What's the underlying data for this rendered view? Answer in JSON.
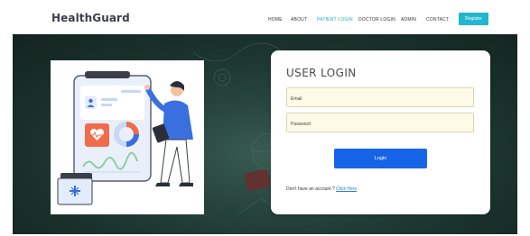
{
  "header": {
    "brand": "HealthGuard",
    "nav": [
      {
        "label": "HOME",
        "active": false
      },
      {
        "label": "ABOUT",
        "active": false
      },
      {
        "label": "PATIENT LOGIN",
        "active": true
      },
      {
        "label": "DOCTOR LOGIN",
        "active": false
      },
      {
        "label": "ADMIN",
        "active": false
      },
      {
        "label": "CONTACT",
        "active": false
      }
    ],
    "register_label": "Register"
  },
  "login": {
    "title": "USER LOGIN",
    "email_placeholder": "Email",
    "password_placeholder": "Password",
    "button_label": "Login",
    "account_prompt": "Don't have an account ?",
    "account_link": "Click Here"
  },
  "colors": {
    "accent": "#20b7cf",
    "primary_button": "#1665e8",
    "link": "#2a7de1",
    "hero_dark": "#1a322b"
  },
  "icons": [
    "user-icon",
    "heart-icon",
    "plus-icon",
    "donut-chart-icon"
  ]
}
